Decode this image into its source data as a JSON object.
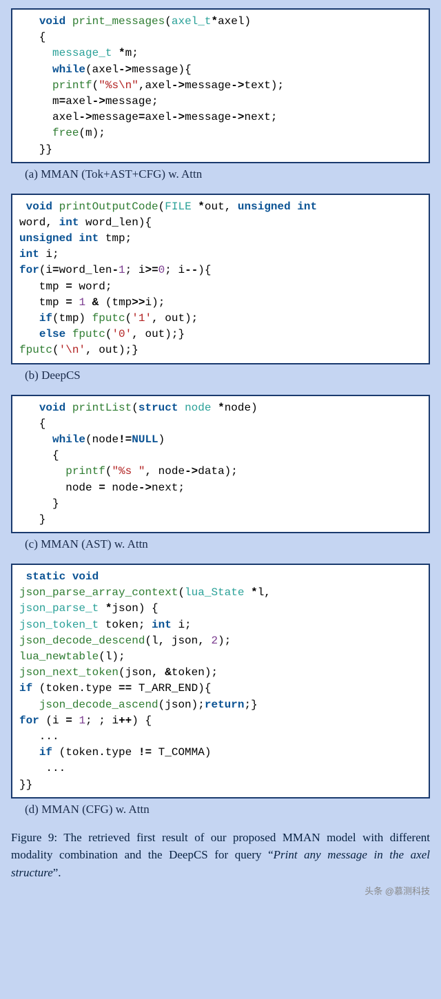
{
  "panels": [
    {
      "code_html": "   <span class='kw-blue'>void</span> <span class='green'>print_messages</span>(<span class='kw-teal'>axel_t</span><span class='op'>*</span>axel)\n   {\n     <span class='kw-teal'>message_t</span> <span class='op'>*</span>m;\n     <span class='kw-blue'>while</span>(axel<span class='op'>-&gt;</span>message){\n     <span class='green'>printf</span>(<span class='red'>\"%s\\n\"</span>,axel<span class='op'>-&gt;</span>message<span class='op'>-&gt;</span>text);\n     m<span class='op'>=</span>axel<span class='op'>-&gt;</span>message;\n     axel<span class='op'>-&gt;</span>message<span class='op'>=</span>axel<span class='op'>-&gt;</span>message<span class='op'>-&gt;</span>next;\n     <span class='green'>free</span>(m);\n   }}",
      "caption": "(a) MMAN (Tok+AST+CFG) w. Attn"
    },
    {
      "code_html": " <span class='kw-blue'>void</span> <span class='green'>printOutputCode</span>(<span class='kw-teal'>FILE</span> <span class='op'>*</span>out, <span class='kw-blue'>unsigned int</span>\nword, <span class='kw-blue'>int</span> word_len){\n<span class='kw-blue'>unsigned int</span> tmp;\n<span class='kw-blue'>int</span> i;\n<span class='kw-blue'>for</span>(i<span class='op'>=</span>word_len<span class='op'>-</span><span class='num'>1</span>; i<span class='op'>&gt;=</span><span class='num'>0</span>; i<span class='op'>--</span>){\n   tmp <span class='op'>=</span> word;\n   tmp <span class='op'>=</span> <span class='num'>1</span> <span class='op'>&amp;</span> (tmp<span class='op'>&gt;&gt;</span>i);\n   <span class='kw-blue'>if</span>(tmp) <span class='green'>fputc</span>(<span class='red'>'1'</span>, out);\n   <span class='kw-blue'>else</span> <span class='green'>fputc</span>(<span class='red'>'0'</span>, out);}\n<span class='green'>fputc</span>(<span class='red'>'\\n'</span>, out);}",
      "caption": "(b) DeepCS"
    },
    {
      "code_html": "   <span class='kw-blue'>void</span> <span class='green'>printList</span>(<span class='kw-blue'>struct</span> <span class='kw-teal'>node</span> <span class='op'>*</span>node)\n   {\n     <span class='kw-blue'>while</span>(node<span class='op'>!=</span><span class='kw-blue'>NULL</span>)\n     {\n       <span class='green'>printf</span>(<span class='red'>\"%s \"</span>, node<span class='op'>-&gt;</span>data);\n       node <span class='op'>=</span> node<span class='op'>-&gt;</span>next;\n     }\n   }",
      "caption": "(c) MMAN (AST) w. Attn"
    },
    {
      "code_html": " <span class='kw-blue'>static void</span>\n<span class='green'>json_parse_array_context</span>(<span class='kw-teal'>lua_State</span> <span class='op'>*</span>l,\n<span class='kw-teal'>json_parse_t</span> <span class='op'>*</span>json) {\n<span class='kw-teal'>json_token_t</span> token; <span class='kw-blue'>int</span> i;\n<span class='green'>json_decode_descend</span>(l, json, <span class='num'>2</span>);\n<span class='green'>lua_newtable</span>(l);\n<span class='green'>json_next_token</span>(json, <span class='op'>&amp;</span>token);\n<span class='kw-blue'>if</span> (token.type <span class='op'>==</span> T_ARR_END){\n   <span class='green'>json_decode_ascend</span>(json);<span class='kw-blue'>return</span>;}\n<span class='kw-blue'>for</span> (i <span class='op'>=</span> <span class='num'>1</span>; ; i<span class='op'>++</span>) {\n   ...\n   <span class='kw-blue'>if</span> (token.type <span class='op'>!=</span> T_COMMA)\n    ...\n}}",
      "caption": "(d) MMAN (CFG) w. Attn"
    }
  ],
  "figure_caption_prefix": "Figure 9: The retrieved first result of our proposed MMAN model with different modality combination and the DeepCS for query “",
  "figure_caption_italic": "Print any message in the axel structure",
  "figure_caption_suffix": "”.",
  "watermark": "头条 @慕测科技"
}
